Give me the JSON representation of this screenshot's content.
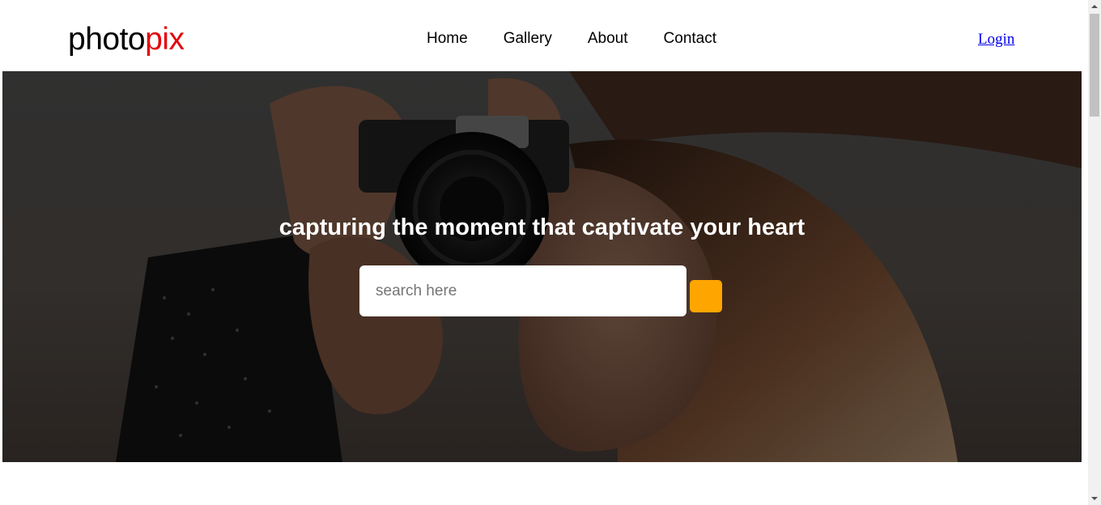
{
  "header": {
    "logo": {
      "part1": "photo",
      "part2": "pix",
      "accent_color": "#e2070c"
    },
    "nav": [
      {
        "label": "Home"
      },
      {
        "label": "Gallery"
      },
      {
        "label": "About"
      },
      {
        "label": "Contact"
      }
    ],
    "login_label": "Login"
  },
  "hero": {
    "title": "capturing the moment that captivate your heart",
    "search": {
      "placeholder": "search here",
      "value": ""
    },
    "search_button_color": "#ffa500",
    "background_image": "woman-holding-camera-photo"
  },
  "scrollbar": {
    "up_icon": "arrow-up-icon",
    "down_icon": "arrow-down-icon"
  }
}
